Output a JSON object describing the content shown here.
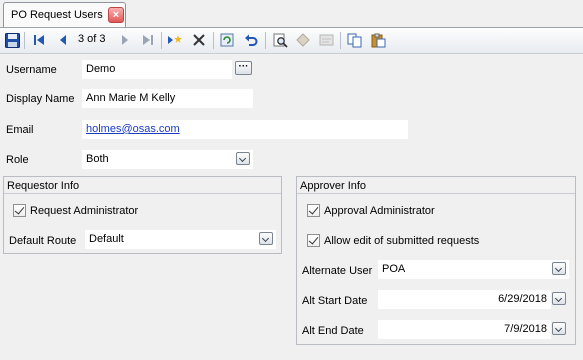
{
  "tab": {
    "title": "PO Request Users",
    "close_glyph": "×"
  },
  "toolbar": {
    "buttons": [
      "save-icon",
      "first-record-icon",
      "previous-record-icon",
      "next-record-icon",
      "last-record-icon",
      "new-record-icon",
      "delete-icon",
      "refresh-icon",
      "undo-icon",
      "find-icon",
      "filter-icon",
      "report-icon",
      "copy-icon",
      "paste-icon"
    ],
    "record_position": "3 of 3"
  },
  "form": {
    "username": {
      "label": "Username",
      "value": "Demo",
      "lookup_glyph": "···"
    },
    "display_name": {
      "label": "Display Name",
      "value": "Ann Marie M Kelly"
    },
    "email": {
      "label": "Email",
      "value": "holmes@osas.com"
    },
    "role": {
      "label": "Role",
      "value": "Both"
    }
  },
  "requestor": {
    "title": "Requestor Info",
    "request_admin": {
      "label": "Request Administrator",
      "checked": true
    },
    "default_route": {
      "label": "Default Route",
      "value": "Default"
    }
  },
  "approver": {
    "title": "Approver Info",
    "approval_admin": {
      "label": "Approval Administrator",
      "checked": true
    },
    "allow_edit": {
      "label": "Allow edit of submitted requests",
      "checked": true
    },
    "alternate_user": {
      "label": "Alternate User",
      "value": "POA"
    },
    "alt_start": {
      "label": "Alt Start Date",
      "value": "6/29/2018"
    },
    "alt_end": {
      "label": "Alt End Date",
      "value": "7/9/2018"
    }
  }
}
